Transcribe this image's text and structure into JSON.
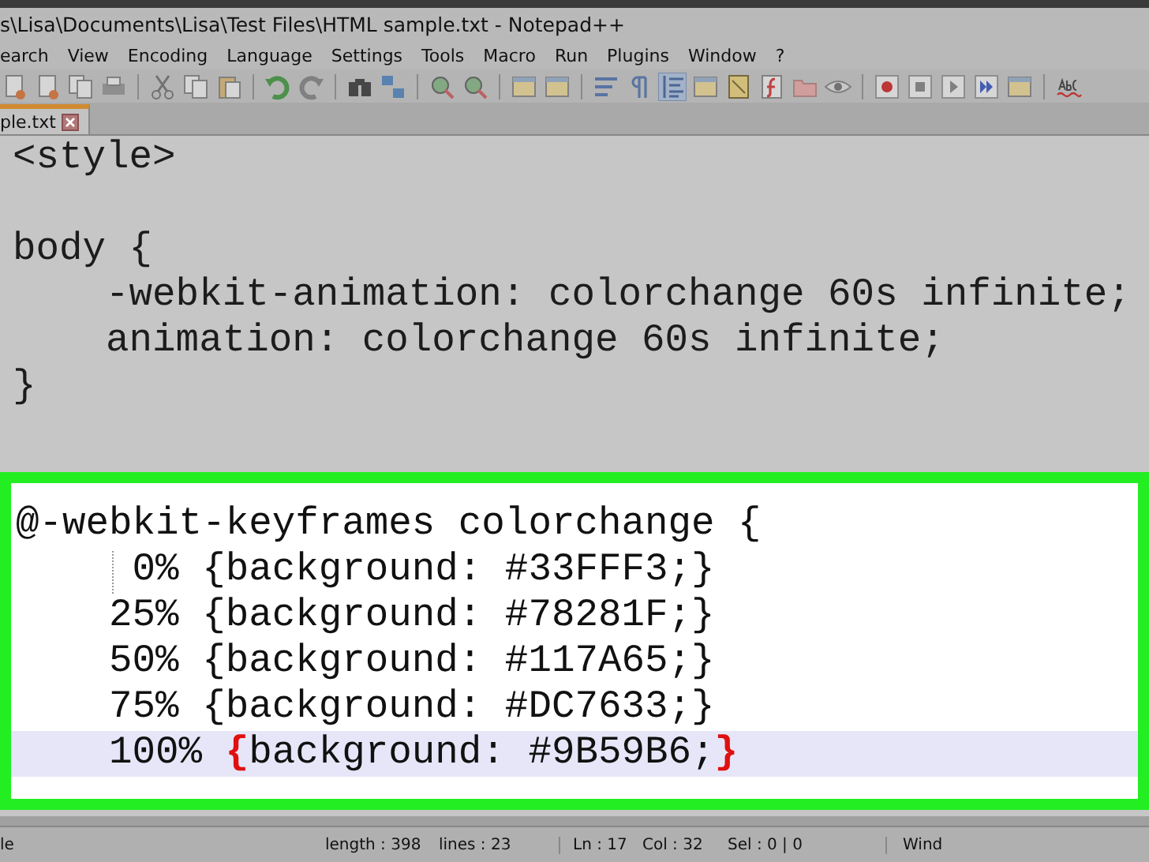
{
  "window": {
    "title": "s\\Lisa\\Documents\\Lisa\\Test Files\\HTML sample.txt - Notepad++"
  },
  "menu": [
    "earch",
    "View",
    "Encoding",
    "Language",
    "Settings",
    "Tools",
    "Macro",
    "Run",
    "Plugins",
    "Window",
    "?"
  ],
  "toolbar": [
    {
      "kind": "page",
      "pressed": false
    },
    {
      "kind": "page",
      "pressed": false
    },
    {
      "kind": "pages",
      "pressed": false
    },
    {
      "kind": "print",
      "pressed": false
    },
    {
      "kind": "sep"
    },
    {
      "kind": "cut",
      "pressed": false
    },
    {
      "kind": "pages",
      "pressed": false
    },
    {
      "kind": "paste",
      "pressed": false
    },
    {
      "kind": "sep"
    },
    {
      "kind": "undo",
      "pressed": false
    },
    {
      "kind": "redo",
      "pressed": false
    },
    {
      "kind": "sep"
    },
    {
      "kind": "find",
      "pressed": false
    },
    {
      "kind": "replace",
      "pressed": false
    },
    {
      "kind": "sep"
    },
    {
      "kind": "zoom",
      "pressed": false
    },
    {
      "kind": "zoom",
      "pressed": false
    },
    {
      "kind": "sep"
    },
    {
      "kind": "window",
      "pressed": false
    },
    {
      "kind": "window",
      "pressed": false
    },
    {
      "kind": "sep"
    },
    {
      "kind": "wrap",
      "pressed": false
    },
    {
      "kind": "pilcrow",
      "pressed": false
    },
    {
      "kind": "guide",
      "pressed": true
    },
    {
      "kind": "window",
      "pressed": false
    },
    {
      "kind": "map",
      "pressed": false
    },
    {
      "kind": "func",
      "pressed": false
    },
    {
      "kind": "folder",
      "pressed": false
    },
    {
      "kind": "eye",
      "pressed": false
    },
    {
      "kind": "sep"
    },
    {
      "kind": "record",
      "pressed": false
    },
    {
      "kind": "stop",
      "pressed": false
    },
    {
      "kind": "play",
      "pressed": false
    },
    {
      "kind": "fast",
      "pressed": false
    },
    {
      "kind": "window",
      "pressed": false
    },
    {
      "kind": "sep"
    },
    {
      "kind": "spell",
      "pressed": false
    }
  ],
  "tabs": [
    {
      "label": "ple.txt",
      "selected": true
    }
  ],
  "editor": {
    "lines": [
      {
        "kind": "code",
        "segments": [
          {
            "text": "<style>",
            "kind": "plain"
          }
        ]
      },
      {
        "kind": "blank"
      },
      {
        "kind": "code",
        "segments": [
          {
            "text": "body {",
            "kind": "plain"
          }
        ]
      },
      {
        "kind": "code",
        "segments": [
          {
            "text": "    -webkit-animation: colorchange 60s infinite;",
            "kind": "plain"
          }
        ]
      },
      {
        "kind": "code",
        "segments": [
          {
            "text": "    animation: colorchange 60s infinite;",
            "kind": "plain"
          }
        ]
      },
      {
        "kind": "code",
        "segments": [
          {
            "text": "}",
            "kind": "plain"
          }
        ]
      },
      {
        "kind": "blank"
      }
    ],
    "highlighted_lines": [
      {
        "kind": "code",
        "segments": [
          {
            "text": "@-webkit-keyframes colorchange {",
            "kind": "plain"
          }
        ]
      },
      {
        "kind": "code",
        "indent_guide": true,
        "segments": [
          {
            "text": "     0% {background: #33FFF3;}",
            "kind": "plain"
          }
        ]
      },
      {
        "kind": "code",
        "segments": [
          {
            "text": "    25% {background: #78281F;}",
            "kind": "plain"
          }
        ]
      },
      {
        "kind": "code",
        "segments": [
          {
            "text": "    50% {background: #117A65;}",
            "kind": "plain"
          }
        ]
      },
      {
        "kind": "code",
        "segments": [
          {
            "text": "    75% {background: #DC7633;}",
            "kind": "plain"
          }
        ]
      },
      {
        "kind": "code",
        "current": true,
        "segments": [
          {
            "text": "    100% ",
            "kind": "plain"
          },
          {
            "text": "{",
            "kind": "brace_match"
          },
          {
            "text": "background: #9B59B6;",
            "kind": "plain"
          },
          {
            "text": "}",
            "kind": "brace_match"
          }
        ]
      }
    ]
  },
  "status_bar": [
    "le",
    "length : 398",
    "lines : 23",
    "Ln : 17",
    "Col : 32",
    "Sel : 0 | 0",
    "Wind"
  ]
}
